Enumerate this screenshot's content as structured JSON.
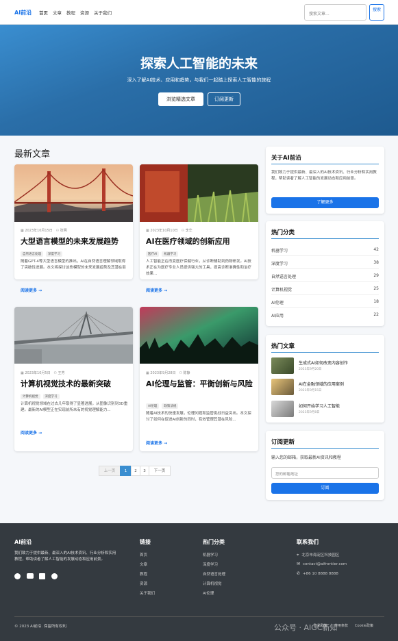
{
  "nav": {
    "brand": "AI前沿",
    "links": [
      "首页",
      "文章",
      "教程",
      "资源",
      "关于我们"
    ],
    "search_placeholder": "搜索文章...",
    "search_button": "搜索"
  },
  "hero": {
    "title": "探索人工智能的未来",
    "subtitle": "深入了解AI技术、应用和趋势，与我们一起踏上探索人工智能的旅程",
    "btn_primary": "浏览精选文章",
    "btn_secondary": "订阅更新"
  },
  "main": {
    "section_title": "最新文章",
    "read_more": "阅读更多 →"
  },
  "articles": [
    {
      "date": "2023年10月15日",
      "author": "张明",
      "title": "大型语言模型的未来发展趋势",
      "tags": [
        "自然语言处理",
        "深度学习"
      ],
      "excerpt": "随着GPT-4等大型语言模型的推出，AI在自然语言理解领域取得了突破性进展。本文将探讨这些模型的未来发展趋势及其潜在影响..."
    },
    {
      "date": "2023年10月10日",
      "author": "李华",
      "title": "AI在医疗领域的创新应用",
      "tags": [
        "医疗AI",
        "机器学习"
      ],
      "excerpt": "人工智能正在改变医疗保健行业，从诊断辅助到药物研发。AI技术正在为医疗专业人员提供强大的工具，提高诊断准确性和治疗效果..."
    },
    {
      "date": "2023年10月5日",
      "author": "王芳",
      "title": "计算机视觉技术的最新突破",
      "tags": [
        "计算机视觉",
        "深度学习"
      ],
      "excerpt": "计算机视觉领域在过去几年取得了显著进展，从图像识别到3D重建。最新的AI模型正在实现前所未有的视觉理解能力..."
    },
    {
      "date": "2023年9月28日",
      "author": "陈静",
      "title": "AI伦理与监管：平衡创新与风险",
      "tags": [
        "AI伦理",
        "政策法规"
      ],
      "excerpt": "随着AI技术的快速发展，伦理问题和监管挑战日益突出。本文探讨了如何在促进AI创新的同时，有效管理其潜在风险..."
    }
  ],
  "pagination": {
    "prev": "上一页",
    "pages": [
      "1",
      "2",
      "3"
    ],
    "next": "下一页"
  },
  "about": {
    "title": "关于AI前沿",
    "text": "我们致力于提供最新、最深入的AI技术资讯、行业分析和实用教程，帮助读者了解人工智能的发展动态和应用前景。",
    "button": "了解更多"
  },
  "categories": {
    "title": "热门分类",
    "items": [
      {
        "name": "机器学习",
        "count": "42"
      },
      {
        "name": "深度学习",
        "count": "38"
      },
      {
        "name": "自然语言处理",
        "count": "29"
      },
      {
        "name": "计算机视觉",
        "count": "25"
      },
      {
        "name": "AI伦理",
        "count": "18"
      },
      {
        "name": "AI应用",
        "count": "22"
      }
    ]
  },
  "hot": {
    "title": "热门文章",
    "items": [
      {
        "title": "生成式AI如何改变内容创作",
        "date": "2023年9月20日"
      },
      {
        "title": "AI在金融领域的应用案例",
        "date": "2023年9月15日"
      },
      {
        "title": "如何开始学习人工智能",
        "date": "2023年9月8日"
      }
    ]
  },
  "subscribe": {
    "title": "订阅更新",
    "text": "输入您的邮箱，获取最新AI资讯和教程",
    "placeholder": "您的邮箱地址",
    "button": "订阅"
  },
  "footer": {
    "brand": "AI前沿",
    "desc": "我们致力于提供最新、最深入的AI技术资讯、行业分析和实用教程，帮助读者了解人工智能的发展动态和应用前景。",
    "links_title": "链接",
    "links": [
      "首页",
      "文章",
      "教程",
      "资源",
      "关于我们"
    ],
    "cats_title": "热门分类",
    "cats": [
      "机器学习",
      "深度学习",
      "自然语言处理",
      "计算机视觉",
      "AI伦理"
    ],
    "contact_title": "联系我们",
    "address": "北京市海淀区科技园区",
    "email": "contact@aifrontier.com",
    "phone": "+86 10 8888 8888",
    "copyright": "© 2023 AI前沿. 保留所有权利.",
    "bottom_links": [
      "隐私政策",
      "使用条款",
      "Cookie政策"
    ],
    "watermark": "公众号 · AIGC新知"
  },
  "colors": {
    "accent": "#1a73e8",
    "hero_start": "#3a8ed0",
    "hero_end": "#1e5a8f",
    "footer": "#343a40"
  }
}
